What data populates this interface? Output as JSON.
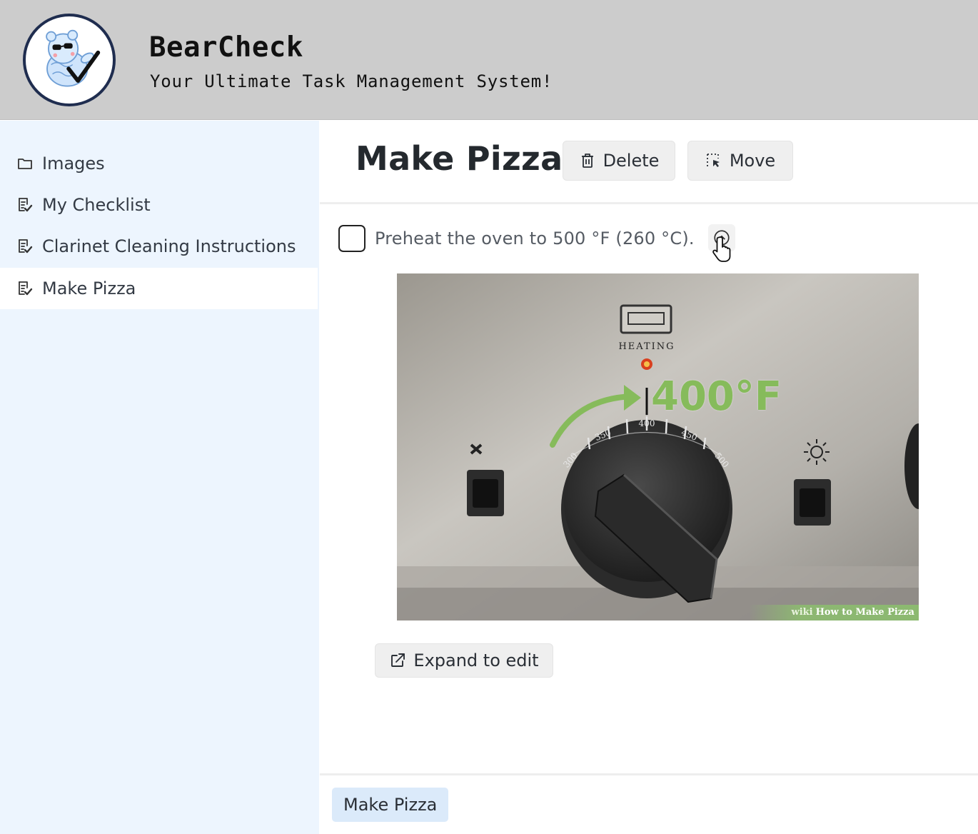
{
  "header": {
    "title": "BearCheck",
    "subtitle": "Your Ultimate Task Management System!"
  },
  "sidebar": {
    "items": [
      {
        "label": "Images",
        "icon": "folder-icon",
        "active": false
      },
      {
        "label": "My Checklist",
        "icon": "checklist-icon",
        "active": false
      },
      {
        "label": "Clarinet Cleaning Instructions",
        "icon": "checklist-icon",
        "active": false
      },
      {
        "label": "Make Pizza",
        "icon": "checklist-icon",
        "active": true
      }
    ]
  },
  "main": {
    "title": "Make Pizza",
    "delete_label": "Delete",
    "move_label": "Move",
    "task": {
      "text": "Preheat the oven to 500 °F (260 °C).",
      "checked": false,
      "image": {
        "heating_label": "HEATING",
        "temperature": "400°F",
        "dial_ticks": [
          "300",
          "350",
          "400",
          "450",
          "500"
        ],
        "watermark_brand": "wiki",
        "watermark_text": "How to Make Pizza"
      }
    },
    "expand_label": "Expand to edit",
    "breadcrumb": "Make Pizza"
  },
  "colors": {
    "header_bg": "#cccccc",
    "sidebar_bg": "#edf5fe",
    "breadcrumb_bg": "#dbeafa",
    "temp_green": "#86bb5b"
  }
}
